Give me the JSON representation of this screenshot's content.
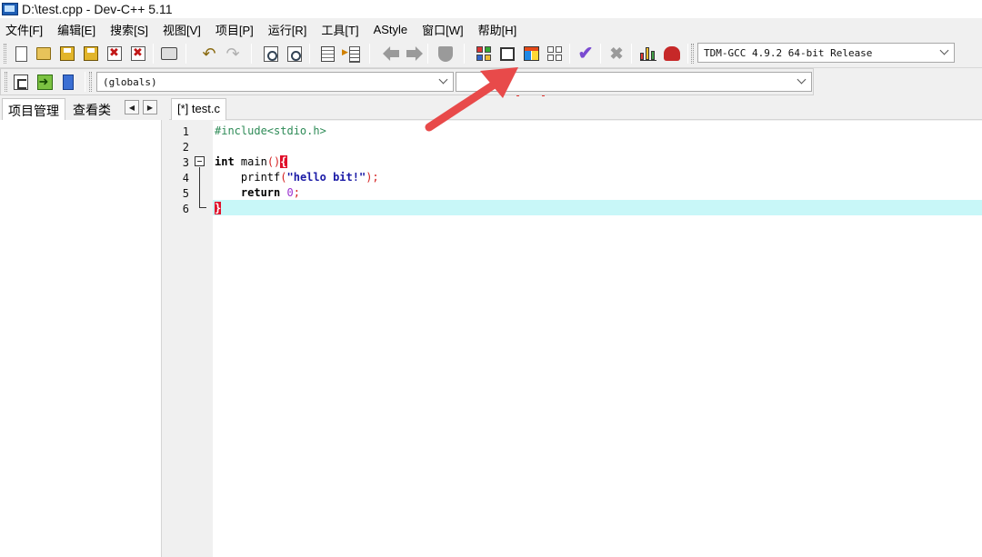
{
  "window": {
    "title": "D:\\test.cpp - Dev-C++ 5.11"
  },
  "menu": [
    "文件[F]",
    "编辑[E]",
    "搜索[S]",
    "视图[V]",
    "项目[P]",
    "运行[R]",
    "工具[T]",
    "AStyle",
    "窗口[W]",
    "帮助[H]"
  ],
  "toolbar": {
    "compiler_select": "TDM-GCC 4.9.2 64-bit Release",
    "scope_select": "(globals)",
    "function_select": ""
  },
  "left_panel": {
    "tabs": [
      "项目管理",
      "查看类"
    ]
  },
  "editor": {
    "tab_label": "[*] test.c",
    "line_numbers": [
      "1",
      "2",
      "3",
      "4",
      "5",
      "6"
    ],
    "code": {
      "l1": "#include<stdio.h>",
      "l3_kw": "int",
      "l3_name": " main",
      "l3_paren": "()",
      "l3_brace": "{",
      "l4_indent": "    ",
      "l4_fn": "printf",
      "l4_open": "(",
      "l4_str": "\"hello bit!\"",
      "l4_close": ");",
      "l5_indent": "    ",
      "l5_kw": "return",
      "l5_num": " 0",
      "l5_semi": ";",
      "l6_brace": "}"
    }
  },
  "colors": {
    "highlight_box": "#e53935",
    "arrow": "#e84a4a",
    "current_line": "#c8f7f8"
  }
}
